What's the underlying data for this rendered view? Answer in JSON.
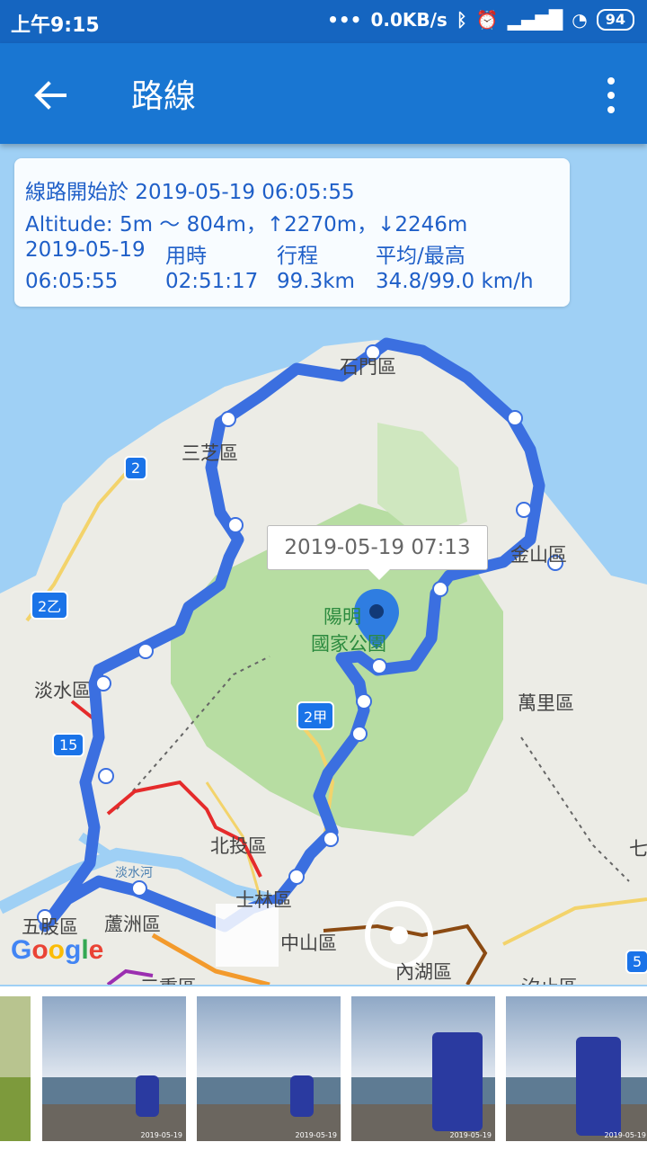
{
  "status_bar": {
    "time": "上午9:15",
    "network_speed": "0.0KB/s",
    "battery": "94",
    "icons": [
      "more-dots-icon",
      "bluetooth-icon",
      "alarm-icon",
      "signal-icon",
      "wifi-icon",
      "battery-icon"
    ]
  },
  "app_bar": {
    "title": "路線",
    "back_icon": "arrow-left-icon",
    "menu_icon": "more-vertical-icon",
    "color": "#1976d2"
  },
  "info_panel": {
    "start_line": "線路開始於 2019-05-19 06:05:55",
    "altitude_line": "Altitude: 5m ～ 804m，↑2270m，↓2246m",
    "date": "2019-05-19",
    "start_time": "06:05:55",
    "duration_label": "用時",
    "duration": "02:51:17",
    "distance_label": "行程",
    "distance": "99.3km",
    "speed_label": "平均/最高",
    "speed": "34.8/99.0 km/h"
  },
  "map": {
    "tooltip": "2019-05-19 07:13",
    "place_labels": {
      "shimen": "石門區",
      "sanzhi": "三芝區",
      "jinshan": "金山區",
      "yangming_line1": "陽明",
      "yangming_line2": "國家公園",
      "tamsui": "淡水區",
      "wanli": "萬里區",
      "beitou": "北投區",
      "shilin": "士林區",
      "wugu": "五股區",
      "luzhou": "蘆洲區",
      "zhongshan": "中山區",
      "neihu": "內湖區",
      "river": "淡水河",
      "sanchong": "三重區",
      "xizhi": "汐止區",
      "qi": "七"
    },
    "road_badges": {
      "r2": "2",
      "r2yi": "2乙",
      "r2jia": "2甲",
      "r15": "15",
      "r5": "5"
    },
    "route_color": "#3b6fe0",
    "pin_color": "#2f7de1",
    "google_logo": "Google"
  },
  "photos": [
    {
      "watermark": ""
    },
    {
      "watermark": "2019-05-19"
    },
    {
      "watermark": "2019-05-19"
    },
    {
      "watermark": "2019-05-19"
    },
    {
      "watermark": "2019-05-19"
    }
  ]
}
